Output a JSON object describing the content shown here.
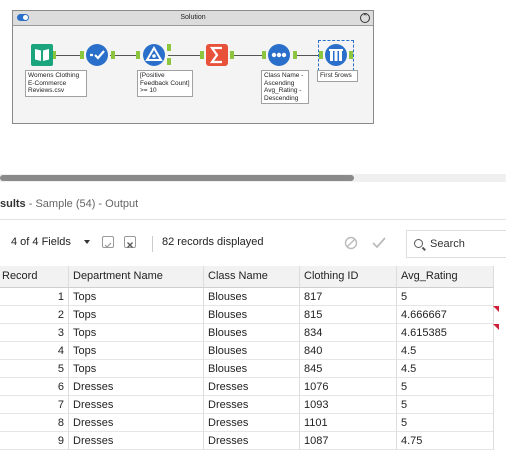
{
  "workflow": {
    "container_title": "Solution",
    "tools": [
      {
        "name": "input",
        "icon": "book-icon",
        "color": "#1aa57c",
        "label": "Womens Clothing\nE-Commerce\nReviews.csv"
      },
      {
        "name": "select",
        "icon": "select-check-icon",
        "color": "#2a6fc9",
        "label": ""
      },
      {
        "name": "filter",
        "icon": "filter-triangle-icon",
        "color": "#2a6fc9",
        "label": "[Positive\nFeedback Count]\n>= 10"
      },
      {
        "name": "summarize",
        "icon": "sigma-icon",
        "color": "#e8523b",
        "label": ""
      },
      {
        "name": "sort",
        "icon": "sort-dots-icon",
        "color": "#2a6fc9",
        "label": "Class Name -\nAscending\nAvg_Rating -\nDescending"
      },
      {
        "name": "sample",
        "icon": "sample-bars-icon",
        "color": "#2a6fc9",
        "label": "First 5rows"
      }
    ]
  },
  "results": {
    "title_bold": "sults",
    "title_rest": " - Sample (54) - Output",
    "fields_label": "4 of 4 Fields",
    "records_label": "82 records displayed",
    "search_placeholder": "Search"
  },
  "grid": {
    "columns": [
      "Record",
      "Department Name",
      "Class Name",
      "Clothing ID",
      "Avg_Rating"
    ],
    "rows": [
      {
        "record": "1",
        "dept": "Tops",
        "cls": "Blouses",
        "id": "817",
        "rating": "5",
        "flag": false
      },
      {
        "record": "2",
        "dept": "Tops",
        "cls": "Blouses",
        "id": "815",
        "rating": "4.666667",
        "flag": true
      },
      {
        "record": "3",
        "dept": "Tops",
        "cls": "Blouses",
        "id": "834",
        "rating": "4.615385",
        "flag": true
      },
      {
        "record": "4",
        "dept": "Tops",
        "cls": "Blouses",
        "id": "840",
        "rating": "4.5",
        "flag": false
      },
      {
        "record": "5",
        "dept": "Tops",
        "cls": "Blouses",
        "id": "845",
        "rating": "4.5",
        "flag": false
      },
      {
        "record": "6",
        "dept": "Dresses",
        "cls": "Dresses",
        "id": "1076",
        "rating": "5",
        "flag": false
      },
      {
        "record": "7",
        "dept": "Dresses",
        "cls": "Dresses",
        "id": "1093",
        "rating": "5",
        "flag": false
      },
      {
        "record": "8",
        "dept": "Dresses",
        "cls": "Dresses",
        "id": "1101",
        "rating": "5",
        "flag": false
      },
      {
        "record": "9",
        "dept": "Dresses",
        "cls": "Dresses",
        "id": "1087",
        "rating": "4.75",
        "flag": false
      }
    ]
  },
  "colors": {
    "accent": "#2a6fc9",
    "flag": "#d0213a",
    "connector": "#8cc63f"
  }
}
